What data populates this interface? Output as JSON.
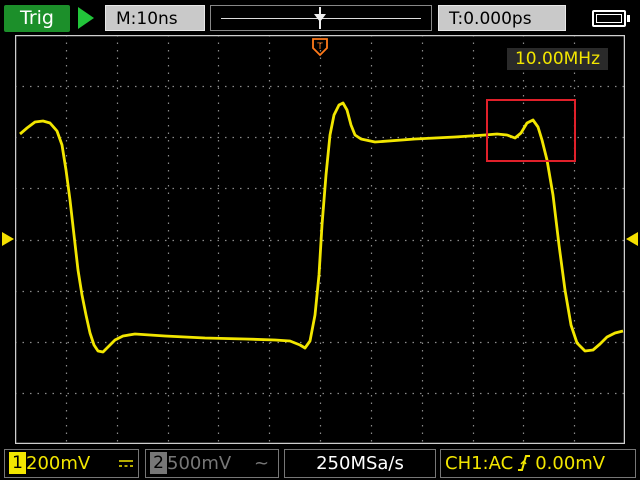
{
  "topbar": {
    "trig_label": "Trig",
    "run_icon": "play-icon",
    "timebase": "M:10ns",
    "trigger_time": "T:0.000ps",
    "battery_icon": "battery-icon"
  },
  "screen": {
    "frequency": "10.00MHz",
    "trigger_marker_glyph": "T",
    "trace_color": "#f2e600",
    "grid_color": "#8a8a8a",
    "highlight_color": "#e0202a"
  },
  "bottombar": {
    "ch1_number": "1",
    "ch1_scale": "200mV",
    "ch1_coupling_icon": "dc-coupling-icon",
    "ch2_number": "2",
    "ch2_scale": "500mV",
    "ch2_coupling": "~",
    "sample_rate": "250MSa/s",
    "trigger_source": "CH1:AC",
    "trigger_edge_icon": "rising-edge-icon",
    "trigger_level": "0.00mV"
  }
}
